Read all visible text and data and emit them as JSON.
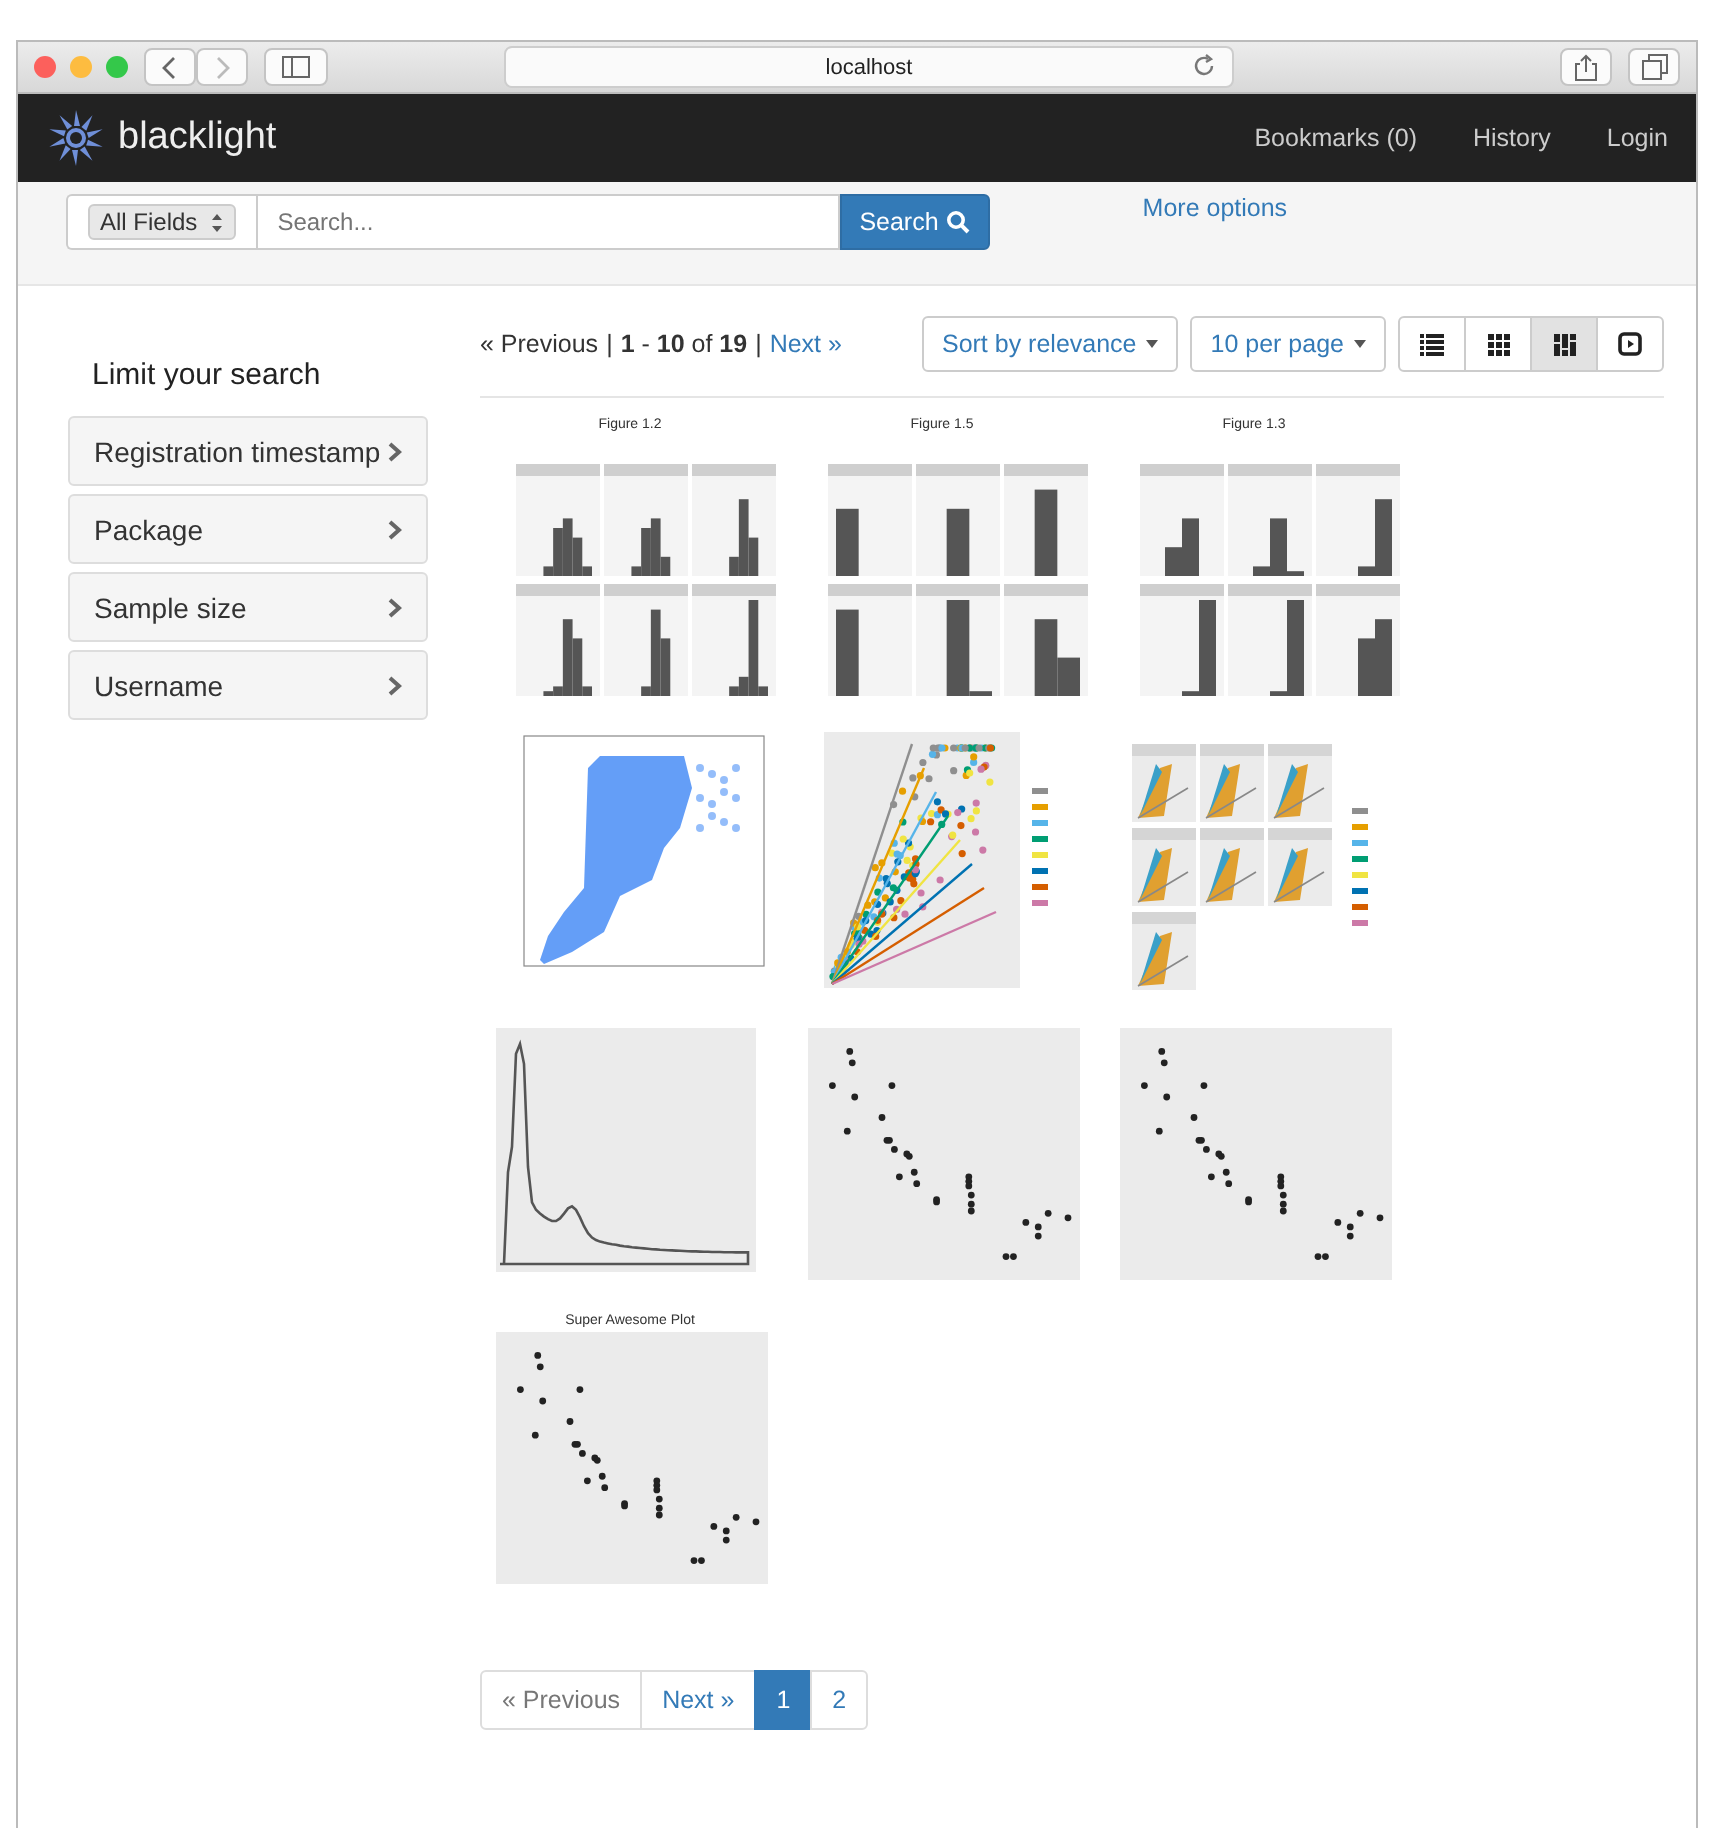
{
  "browser": {
    "address": "localhost"
  },
  "navbar": {
    "brand": "blacklight",
    "links": [
      "Bookmarks (0)",
      "History",
      "Login"
    ]
  },
  "search": {
    "field_select": "All Fields",
    "placeholder": "Search...",
    "button": "Search",
    "more_options": "More options"
  },
  "sidebar": {
    "title": "Limit your search",
    "facets": [
      {
        "label": "Registration timestamp"
      },
      {
        "label": "Package"
      },
      {
        "label": "Sample size"
      },
      {
        "label": "Username"
      }
    ]
  },
  "results_header": {
    "previous": "« Previous",
    "divider_left": "|",
    "divider_right": "|",
    "range": "**1** - **10** of **19**",
    "next": "Next »",
    "sort": "Sort by relevance",
    "per_page": "10 per page",
    "view_modes": [
      {
        "kind": "list",
        "selected": false
      },
      {
        "kind": "gallery",
        "selected": false
      },
      {
        "kind": "masonry",
        "selected": true
      },
      {
        "kind": "slideshow",
        "selected": false
      }
    ]
  },
  "results": [
    {
      "kind": "histogram_grid",
      "title": "Figure 1.2"
    },
    {
      "kind": "histogram_grid",
      "title": "Figure 1.5"
    },
    {
      "kind": "histogram_grid",
      "title": "Figure 1.3"
    },
    {
      "kind": "blue_scatter"
    },
    {
      "kind": "colored_scatter"
    },
    {
      "kind": "faceted_scatter"
    },
    {
      "kind": "density"
    },
    {
      "kind": "point_scatter"
    },
    {
      "kind": "point_scatter"
    },
    {
      "kind": "point_scatter",
      "title": "Super Awesome Plot"
    }
  ],
  "pagination": [
    {
      "label": "« Previous",
      "disabled": true,
      "selected": false
    },
    {
      "label": "Next »",
      "disabled": false,
      "selected": false
    },
    {
      "label": "1",
      "disabled": false,
      "selected": true
    },
    {
      "label": "2",
      "disabled": false,
      "selected": false
    }
  ]
}
